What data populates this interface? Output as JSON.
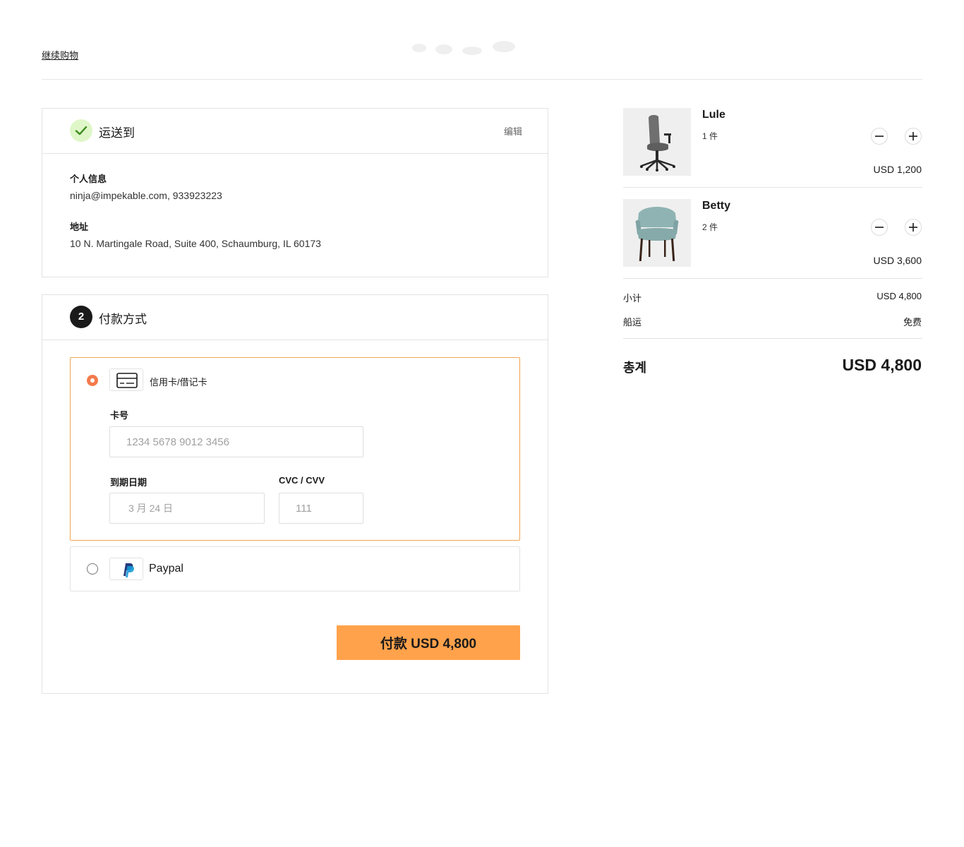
{
  "header": {
    "continue_shopping": "继续购物"
  },
  "shipping": {
    "title": "运送到",
    "edit_label": "编辑",
    "personal_info_label": "个人信息",
    "personal_info_value": "ninja@impekable.com, 933923223",
    "address_label": "地址",
    "address_value": "10 N. Martingale Road, Suite 400, Schaumburg, IL 60173",
    "status_icon": "check-icon",
    "status_color": "#dff7c8"
  },
  "payment": {
    "step_number": "2",
    "title": "付款方式",
    "options": [
      {
        "label": "信用卡/借记卡",
        "icon": "credit-card-icon",
        "selected": true
      },
      {
        "label": "Paypal",
        "icon": "paypal-icon",
        "selected": false
      }
    ],
    "card_number_label": "卡号",
    "card_number_placeholder": "1234 5678 9012 3456",
    "expiry_label": "到期日期",
    "expiry_placeholder": "3 月 24 日",
    "cvc_label": "CVC / CVV",
    "cvc_placeholder": "111",
    "pay_button_label": "付款 USD 4,800",
    "accent_color": "#ffa24b",
    "radio_color": "#f47a4c"
  },
  "order": {
    "items": [
      {
        "name": "Lule",
        "quantity": "1 件",
        "price": "USD 1,200"
      },
      {
        "name": "Betty",
        "quantity": "2 件",
        "price": "USD 3,600"
      }
    ],
    "subtotal_label": "小计",
    "subtotal_value": "USD 4,800",
    "shipping_label": "船运",
    "shipping_value": "免费",
    "total_label": "총계",
    "total_value": "USD 4,800"
  }
}
